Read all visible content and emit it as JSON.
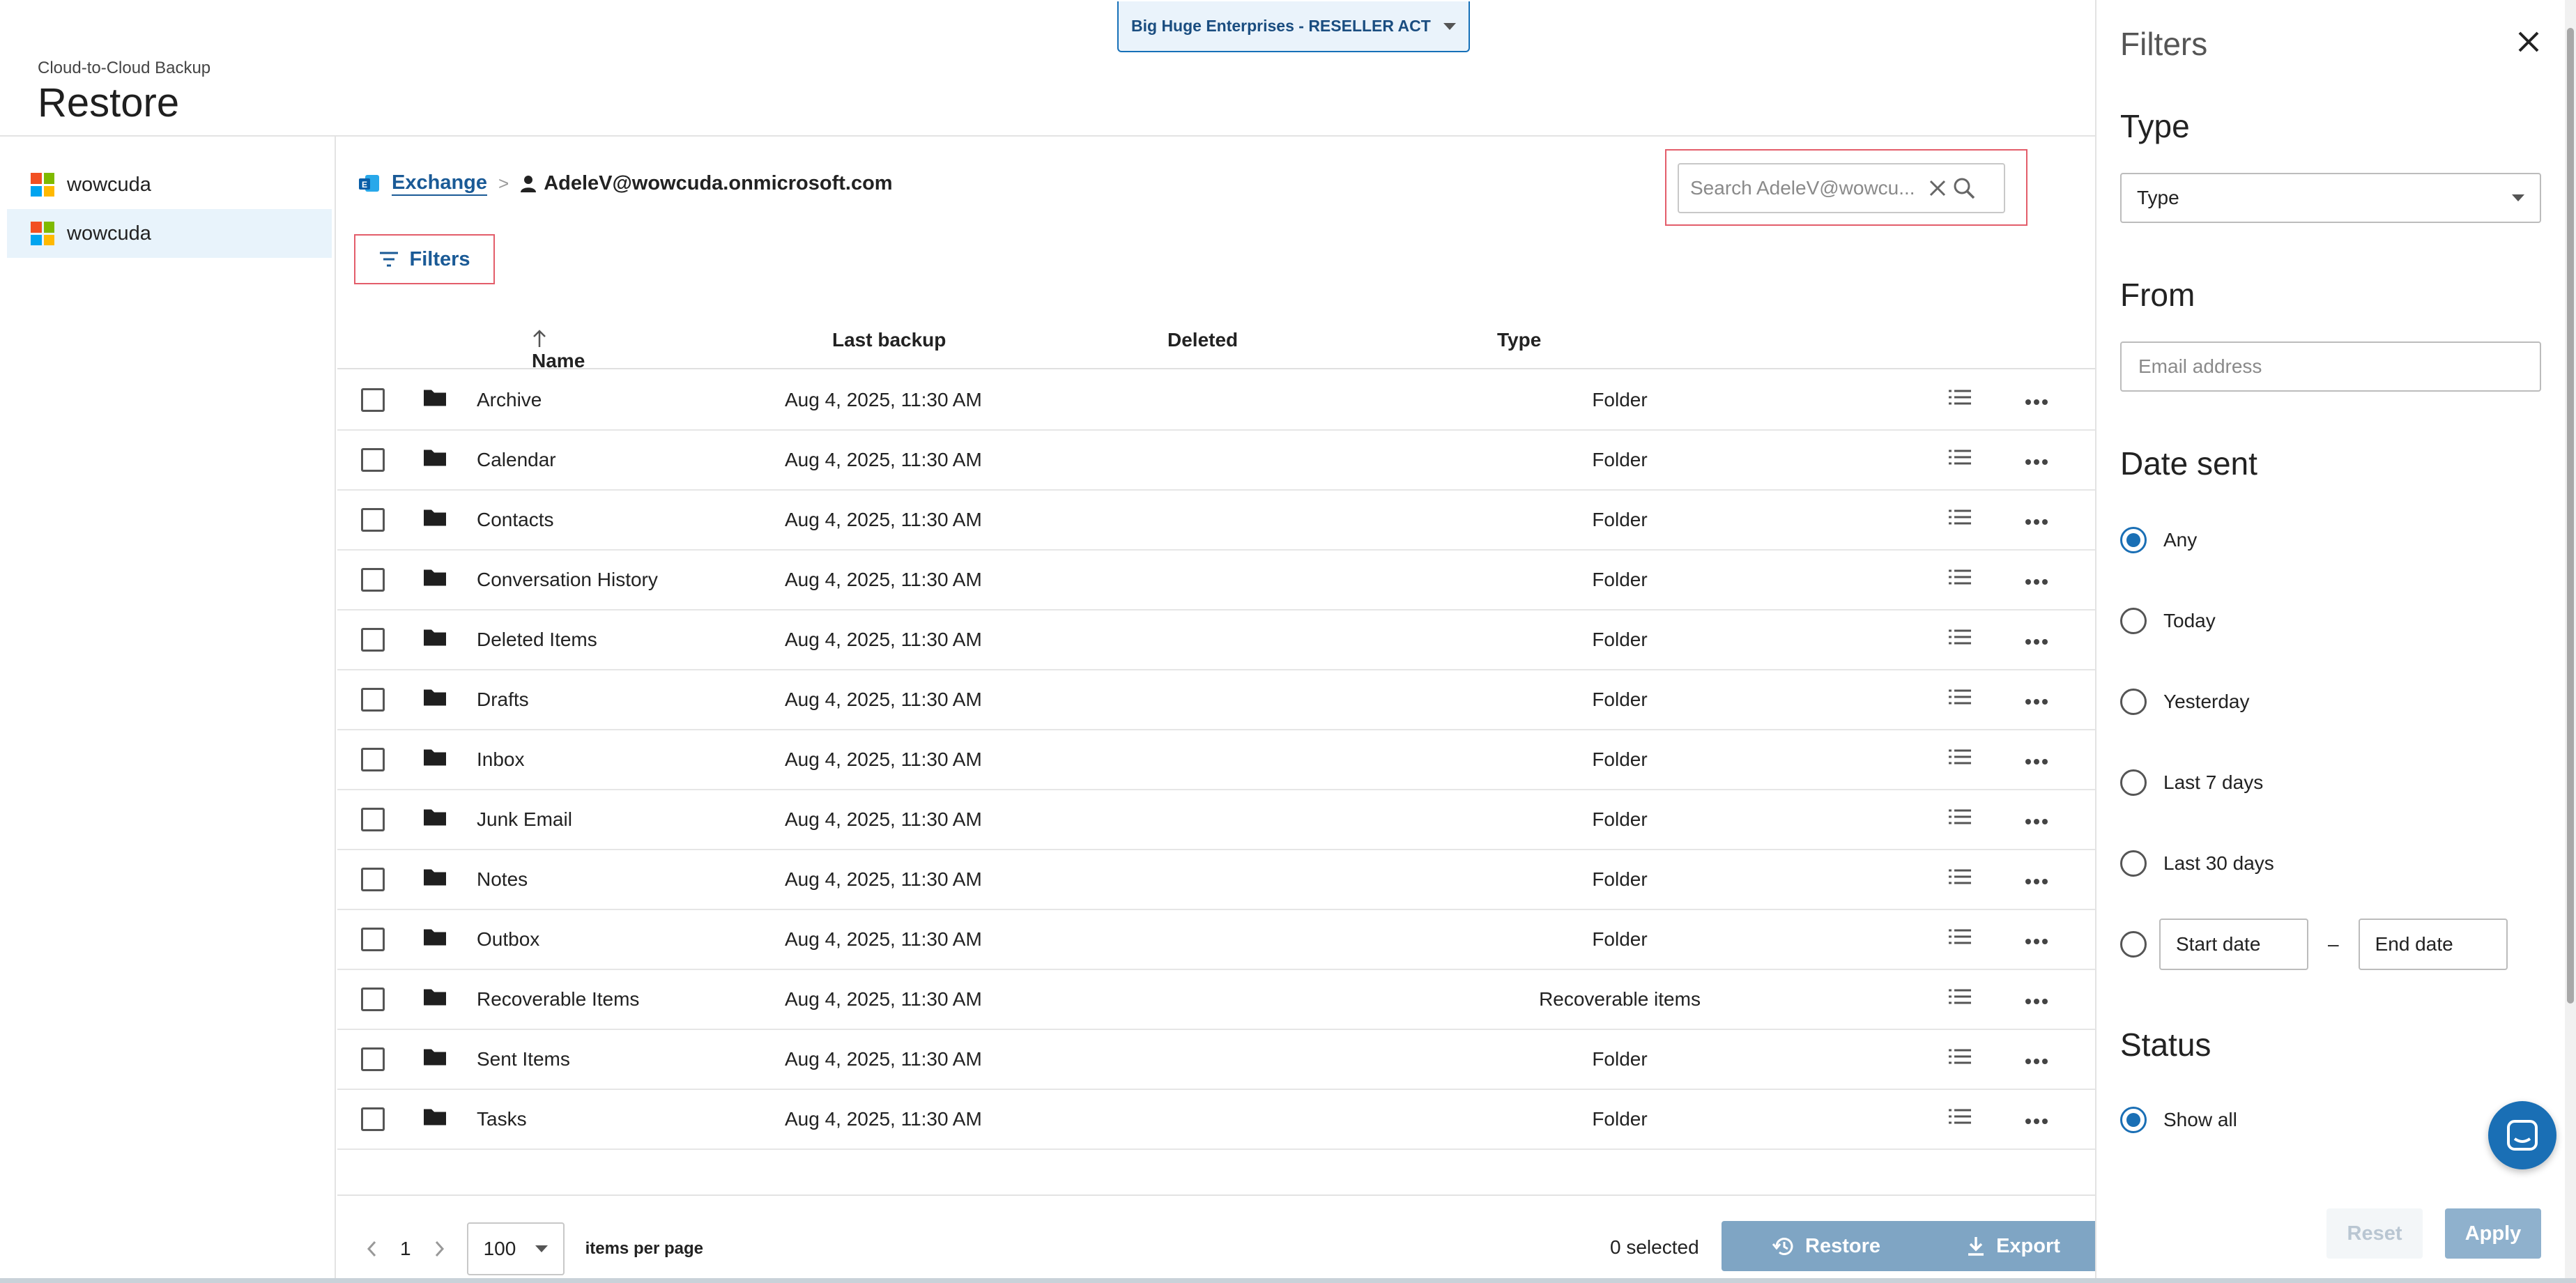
{
  "account": {
    "label": "Big Huge Enterprises - RESELLER ACT"
  },
  "header": {
    "subtitle": "Cloud-to-Cloud Backup",
    "title": "Restore"
  },
  "sidebar": {
    "items": [
      {
        "label": "wowcuda"
      },
      {
        "label": "wowcuda"
      }
    ]
  },
  "breadcrumb": {
    "service": "Exchange",
    "separator": ">",
    "user": "AdeleV@wowcuda.onmicrosoft.com"
  },
  "search": {
    "placeholder": "Search AdeleV@wowcu..."
  },
  "toolbar": {
    "filters_label": "Filters"
  },
  "table": {
    "columns": {
      "name": "Name",
      "last_backup": "Last backup",
      "deleted": "Deleted",
      "type": "Type"
    },
    "rows": [
      {
        "name": "Archive",
        "last_backup": "Aug 4, 2025, 11:30 AM",
        "type": "Folder"
      },
      {
        "name": "Calendar",
        "last_backup": "Aug 4, 2025, 11:30 AM",
        "type": "Folder"
      },
      {
        "name": "Contacts",
        "last_backup": "Aug 4, 2025, 11:30 AM",
        "type": "Folder"
      },
      {
        "name": "Conversation History",
        "last_backup": "Aug 4, 2025, 11:30 AM",
        "type": "Folder"
      },
      {
        "name": "Deleted Items",
        "last_backup": "Aug 4, 2025, 11:30 AM",
        "type": "Folder"
      },
      {
        "name": "Drafts",
        "last_backup": "Aug 4, 2025, 11:30 AM",
        "type": "Folder"
      },
      {
        "name": "Inbox",
        "last_backup": "Aug 4, 2025, 11:30 AM",
        "type": "Folder"
      },
      {
        "name": "Junk Email",
        "last_backup": "Aug 4, 2025, 11:30 AM",
        "type": "Folder"
      },
      {
        "name": "Notes",
        "last_backup": "Aug 4, 2025, 11:30 AM",
        "type": "Folder"
      },
      {
        "name": "Outbox",
        "last_backup": "Aug 4, 2025, 11:30 AM",
        "type": "Folder"
      },
      {
        "name": "Recoverable Items",
        "last_backup": "Aug 4, 2025, 11:30 AM",
        "type": "Recoverable items"
      },
      {
        "name": "Sent Items",
        "last_backup": "Aug 4, 2025, 11:30 AM",
        "type": "Folder"
      },
      {
        "name": "Tasks",
        "last_backup": "Aug 4, 2025, 11:30 AM",
        "type": "Folder"
      }
    ]
  },
  "footer": {
    "page": "1",
    "per_page": "100",
    "per_page_label": "items per page",
    "selected": "0 selected",
    "restore_label": "Restore",
    "export_label": "Export"
  },
  "filters": {
    "title": "Filters",
    "type_heading": "Type",
    "type_value": "Type",
    "from_heading": "From",
    "from_placeholder": "Email address",
    "date_heading": "Date sent",
    "date_options": [
      "Any",
      "Today",
      "Yesterday",
      "Last 7 days",
      "Last 30 days"
    ],
    "date_selected": "Any",
    "start_date": "Start date",
    "range_sep": "–",
    "end_date": "End date",
    "status_heading": "Status",
    "status_option": "Show all",
    "reset_label": "Reset",
    "apply_label": "Apply"
  },
  "colors": {
    "accent": "#1a6fb5",
    "button_disabled": "#7fa5c4",
    "highlight_border": "#e35d6a",
    "active_row": "#e8f3fb"
  },
  "icons": [
    "microsoft-logo-icon",
    "exchange-icon",
    "person-icon",
    "clear-icon",
    "search-icon",
    "filter-icon",
    "sort-arrow-up-icon",
    "folder-icon",
    "list-icon",
    "more-icon",
    "chevron-left-icon",
    "chevron-right-icon",
    "history-icon",
    "download-icon",
    "close-icon",
    "chat-icon"
  ]
}
